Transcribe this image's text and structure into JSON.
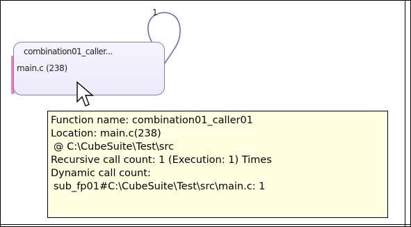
{
  "node": {
    "title": "combination01_caller...",
    "location": "main.c (238)",
    "loop_count": "1"
  },
  "tooltip": {
    "function_name": "Function name: combination01_caller01",
    "location": "Location: main.c(238)",
    "path": " @ C:\\CubeSuite\\Test\\src",
    "recursive": "Recursive call count: 1 (Execution: 1) Times",
    "dynamic_label": "Dynamic call count:",
    "dynamic_value": " sub_fp01#C:\\CubeSuite\\Test\\src\\main.c: 1"
  },
  "colors": {
    "tooltip_bg": "#ffffe1",
    "node_border": "#7f7fbf",
    "node_accent": "#ef7fb0"
  },
  "icons": {
    "cursor": "arrow-cursor-icon"
  }
}
